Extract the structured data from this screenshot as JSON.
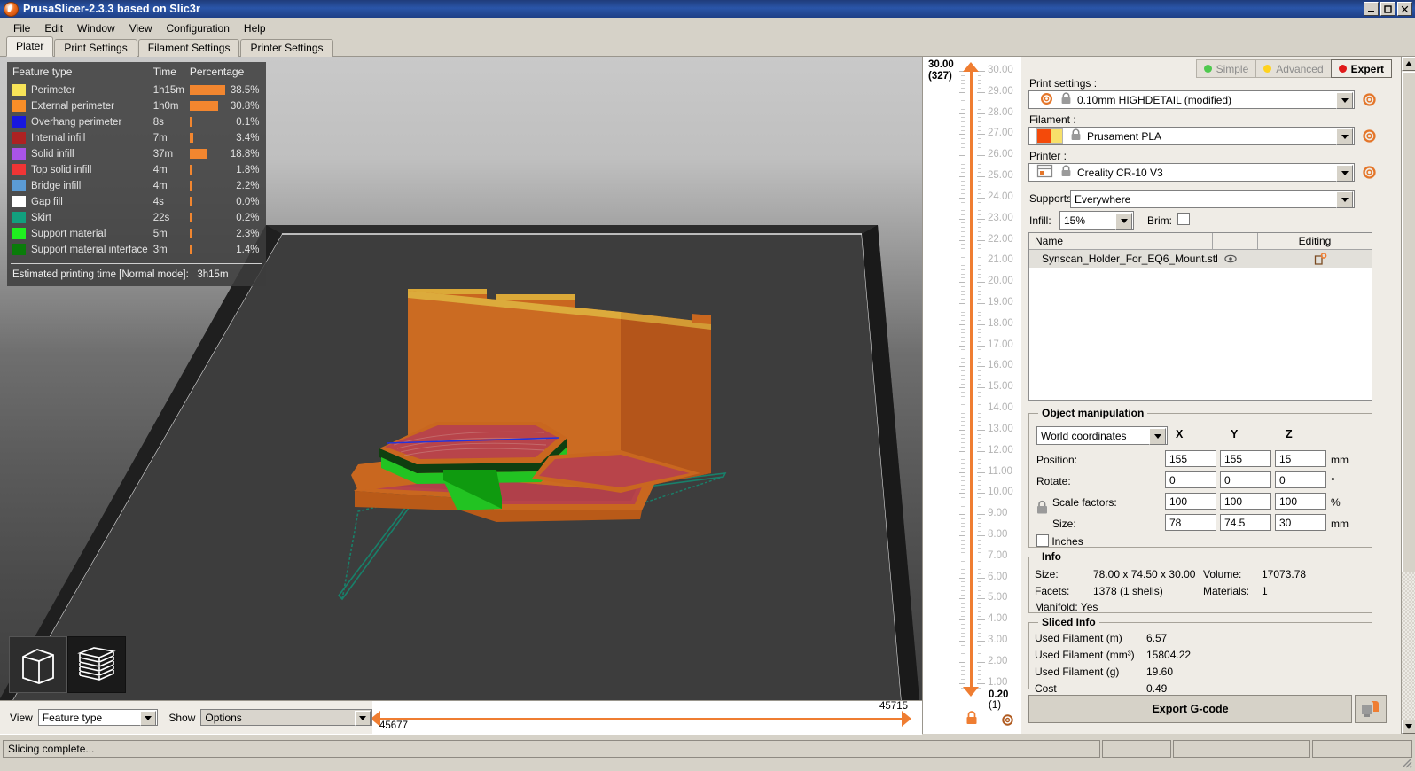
{
  "window": {
    "title": "PrusaSlicer-2.3.3 based on Slic3r",
    "icon": "prusaslicer-logo-icon",
    "minimize": "–",
    "maximize": "❐",
    "close": "✕"
  },
  "menu": [
    "File",
    "Edit",
    "Window",
    "View",
    "Configuration",
    "Help"
  ],
  "tabs": [
    {
      "label": "Plater",
      "active": true
    },
    {
      "label": "Print Settings",
      "active": false
    },
    {
      "label": "Filament Settings",
      "active": false
    },
    {
      "label": "Printer Settings",
      "active": false
    }
  ],
  "legend": {
    "headers": {
      "feature": "Feature type",
      "time": "Time",
      "percentage": "Percentage"
    },
    "rows": [
      {
        "label": "Perimeter",
        "time": "1h15m",
        "pct": "38.5%",
        "value": 38.5,
        "color": "#f7e358"
      },
      {
        "label": "External perimeter",
        "time": "1h0m",
        "pct": "30.8%",
        "value": 30.8,
        "color": "#f98e28"
      },
      {
        "label": "Overhang perimeter",
        "time": "8s",
        "pct": "0.1%",
        "value": 0.1,
        "color": "#1717e0"
      },
      {
        "label": "Internal infill",
        "time": "7m",
        "pct": "3.4%",
        "value": 3.4,
        "color": "#ad2222"
      },
      {
        "label": "Solid infill",
        "time": "37m",
        "pct": "18.8%",
        "value": 18.8,
        "color": "#a954e8"
      },
      {
        "label": "Top solid infill",
        "time": "4m",
        "pct": "1.8%",
        "value": 1.8,
        "color": "#f03535"
      },
      {
        "label": "Bridge infill",
        "time": "4m",
        "pct": "2.2%",
        "value": 2.2,
        "color": "#5b9bd5"
      },
      {
        "label": "Gap fill",
        "time": "4s",
        "pct": "0.0%",
        "value": 0.0,
        "color": "#ffffff"
      },
      {
        "label": "Skirt",
        "time": "22s",
        "pct": "0.2%",
        "value": 0.2,
        "color": "#12a07e"
      },
      {
        "label": "Support material",
        "time": "5m",
        "pct": "2.3%",
        "value": 2.3,
        "color": "#1ff01f"
      },
      {
        "label": "Support material interface",
        "time": "3m",
        "pct": "1.4%",
        "value": 1.4,
        "color": "#0a7c0a"
      }
    ],
    "footer": "Estimated printing time [Normal mode]:",
    "footer_value": "3h15m",
    "bar_color": "#f2862f"
  },
  "viewtools": [
    {
      "name": "editor-view",
      "selected": false
    },
    {
      "name": "preview-view",
      "selected": true
    }
  ],
  "bottombar": {
    "view_label": "View",
    "view_value": "Feature type",
    "show_label": "Show",
    "show_value": "Options"
  },
  "hslider": {
    "left_value": "45677",
    "right_value": "45715"
  },
  "vslider": {
    "top_value": "30.00",
    "top_layer": "(327)",
    "bottom_value": "0.20",
    "bottom_layer": "(1)",
    "ticks": [
      "30.00",
      "29.00",
      "28.00",
      "27.00",
      "26.00",
      "25.00",
      "24.00",
      "23.00",
      "22.00",
      "21.00",
      "20.00",
      "19.00",
      "18.00",
      "17.00",
      "16.00",
      "15.00",
      "14.00",
      "13.00",
      "12.00",
      "11.00",
      "10.00",
      "9.00",
      "8.00",
      "7.00",
      "6.00",
      "5.00",
      "4.00",
      "3.00",
      "2.00",
      "1.00"
    ]
  },
  "modes": [
    {
      "label": "Simple",
      "color": "#4ec94e",
      "active": false
    },
    {
      "label": "Advanced",
      "color": "#ffd21e",
      "active": false
    },
    {
      "label": "Expert",
      "color": "#e01b1b",
      "active": true
    }
  ],
  "presets": {
    "print_label": "Print settings :",
    "print_value": "0.10mm HIGHDETAIL (modified)",
    "filament_label": "Filament :",
    "filament_value": "Prusament PLA",
    "printer_label": "Printer :",
    "printer_value": "Creality CR-10 V3",
    "supports_label": "Supports:",
    "supports_value": "Everywhere",
    "infill_label": "Infill:",
    "infill_value": "15%",
    "brim_label": "Brim:"
  },
  "objectlist": {
    "col_name": "Name",
    "col_blank": "",
    "col_editing": "Editing",
    "rows": [
      {
        "name": "Synscan_Holder_For_EQ6_Mount.stl",
        "eye": "eye-icon",
        "editing": "settings-icon"
      }
    ]
  },
  "manipulation": {
    "title": "Object manipulation",
    "coordinate_system": "World coordinates",
    "axes": [
      "X",
      "Y",
      "Z"
    ],
    "rows": [
      {
        "label": "Position:",
        "x": "155",
        "y": "155",
        "z": "15",
        "unit": "mm"
      },
      {
        "label": "Rotate:",
        "x": "0",
        "y": "0",
        "z": "0",
        "unit": "°"
      },
      {
        "label": "Scale factors:",
        "x": "100",
        "y": "100",
        "z": "100",
        "unit": "%"
      },
      {
        "label": "Size:",
        "x": "78",
        "y": "74.5",
        "z": "30",
        "unit": "mm"
      }
    ],
    "inches_label": "Inches"
  },
  "info": {
    "title": "Info",
    "size_label": "Size:",
    "size_value": "78.00 x 74.50 x 30.00",
    "volume_label": "Volume:",
    "volume_value": "17073.78",
    "facets_label": "Facets:",
    "facets_value": "1378 (1 shells)",
    "materials_label": "Materials:",
    "materials_value": "1",
    "manifold_label": "Manifold: Yes"
  },
  "sliced": {
    "title": "Sliced Info",
    "rows": [
      {
        "label": "Used Filament (m)",
        "value": "6.57"
      },
      {
        "label": "Used Filament (mm³)",
        "value": "15804.22"
      },
      {
        "label": "Used Filament (g)",
        "value": "19.60"
      },
      {
        "label": "Cost",
        "value": "0.49"
      }
    ]
  },
  "actions": {
    "export_label": "Export G-code",
    "send_icon": "send-to-printer-icon"
  },
  "statusbar": {
    "message": "Slicing complete..."
  },
  "accent": "#ef7d31"
}
